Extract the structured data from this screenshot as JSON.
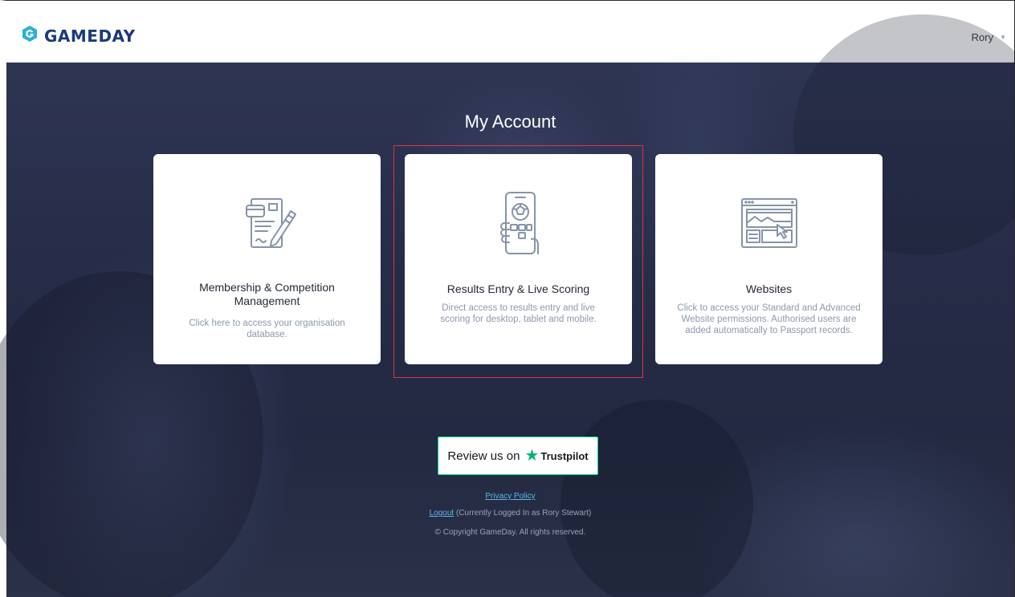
{
  "header": {
    "logo_text": "GAMEDAY",
    "user_name": "Rory",
    "brand_color": "#1b3a7a",
    "logo_accent": "#2ab0d8"
  },
  "main": {
    "title": "My Account",
    "cards": [
      {
        "title_line1": "Membership & Competition",
        "title_line2": "Management",
        "desc_line1": "Click here to access your organisation",
        "desc_line2": "database.",
        "icon": "document-pen-icon"
      },
      {
        "title_line1": "Results Entry & Live Scoring",
        "desc_line1": "Direct access to results entry and live",
        "desc_line2": "scoring for desktop, tablet and mobile.",
        "icon": "phone-soccer-ball-icon",
        "highlighted": true
      },
      {
        "title_line1": "Websites",
        "desc_line1": "Click to access your Standard and Advanced",
        "desc_line2": "Website permissions. Authorised users are",
        "desc_line3": "added automatically to Passport records.",
        "icon": "browser-window-icon"
      }
    ]
  },
  "trustpilot": {
    "prefix": "Review us on",
    "brand": "Trustpilot",
    "accent": "#00b67a"
  },
  "footer": {
    "privacy": "Privacy Policy",
    "logout": "Logout",
    "logged_in": "(Currently Logged In as Rory Stewart)",
    "copyright": "© Copyright GameDay. All rights reserved."
  },
  "colors": {
    "highlight_border": "#d9363e",
    "icon_stroke": "#8693ab",
    "link": "#5ab8e8"
  }
}
